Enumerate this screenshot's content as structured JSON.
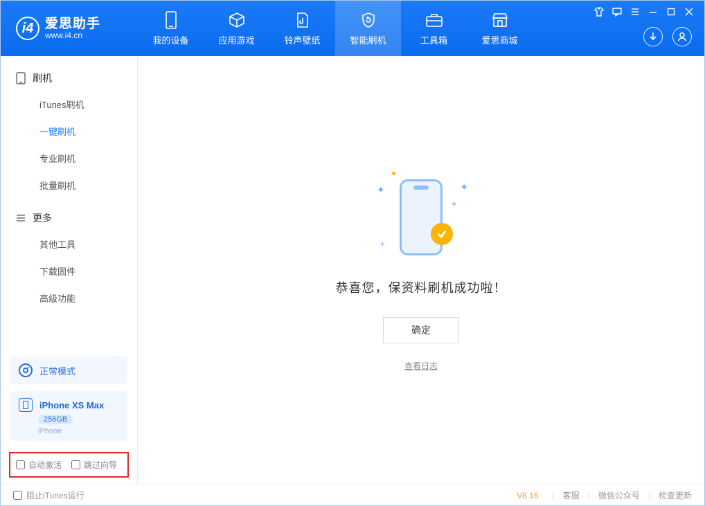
{
  "app": {
    "title": "爱思助手",
    "subtitle": "www.i4.cn"
  },
  "tabs": {
    "device": "我的设备",
    "apps": "应用游戏",
    "ring": "铃声壁纸",
    "flash": "智能刷机",
    "tools": "工具箱",
    "store": "爱思商城"
  },
  "sidebar": {
    "group_flash": "刷机",
    "items_flash": {
      "itunes": "iTunes刷机",
      "onekey": "一键刷机",
      "pro": "专业刷机",
      "batch": "批量刷机"
    },
    "group_more": "更多",
    "items_more": {
      "other": "其他工具",
      "firmware": "下载固件",
      "adv": "高级功能"
    }
  },
  "device_mode": {
    "label": "正常模式"
  },
  "device": {
    "name": "iPhone XS Max",
    "storage": "256GB",
    "type": "iPhone"
  },
  "options": {
    "auto_activate": "自动激活",
    "skip_guide": "跳过向导"
  },
  "result": {
    "message": "恭喜您，保资料刷机成功啦！",
    "ok": "确定",
    "view_log": "查看日志"
  },
  "footer": {
    "block_itunes": "阻止iTunes运行",
    "version": "V8.16",
    "support": "客服",
    "wechat": "微信公众号",
    "update": "检查更新"
  }
}
